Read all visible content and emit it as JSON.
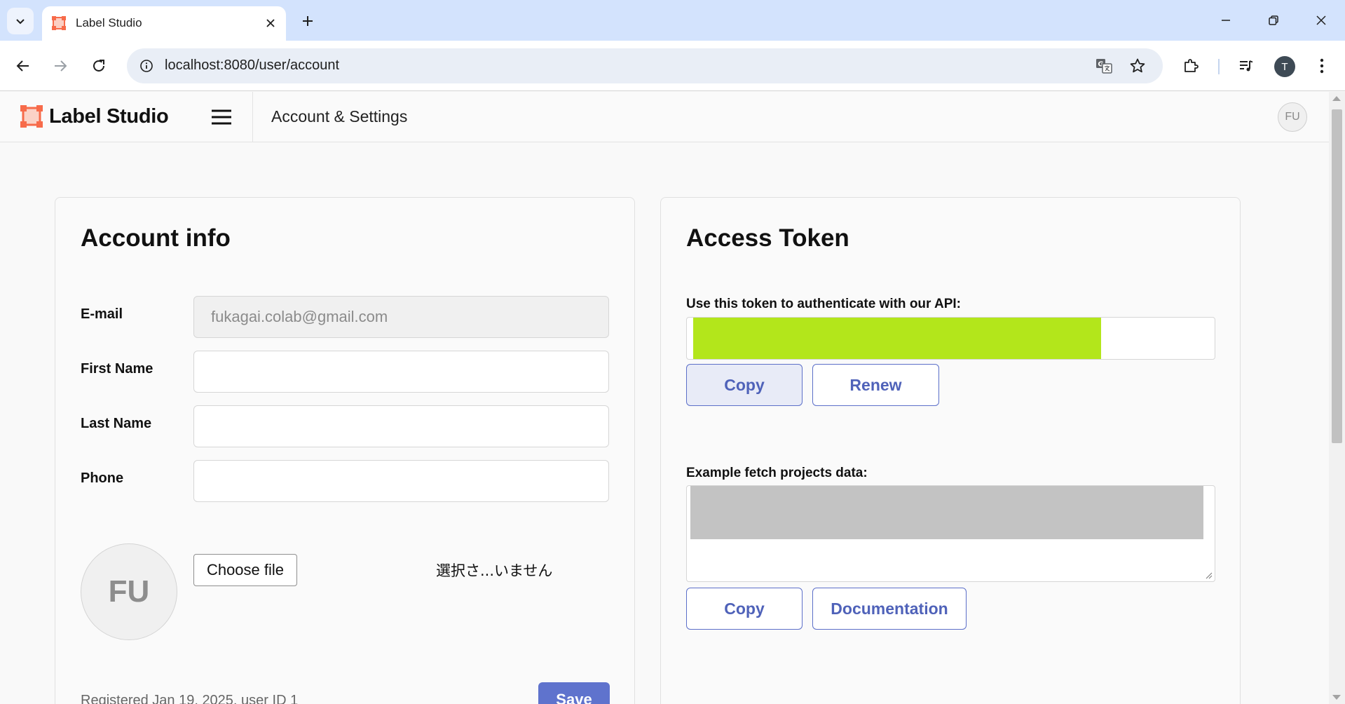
{
  "browser": {
    "tab_title": "Label Studio",
    "url": "localhost:8080/user/account",
    "profile_initial": "T"
  },
  "header": {
    "brand": "Label Studio",
    "page_title": "Account & Settings",
    "user_initials": "FU"
  },
  "account": {
    "title": "Account info",
    "email_label": "E-mail",
    "email_value": "fukagai.colab@gmail.com",
    "first_name_label": "First Name",
    "first_name_value": "",
    "last_name_label": "Last Name",
    "last_name_value": "",
    "phone_label": "Phone",
    "phone_value": "",
    "avatar_initials": "FU",
    "choose_file_label": "Choose file",
    "no_file_text": "選択さ...いません",
    "registered_text": "Registered Jan 19, 2025, user ID 1",
    "save_label": "Save"
  },
  "token": {
    "title": "Access Token",
    "instruction": "Use this token to authenticate with our API:",
    "copy_label": "Copy",
    "renew_label": "Renew",
    "example_label": "Example fetch projects data:",
    "example_copy_label": "Copy",
    "documentation_label": "Documentation"
  },
  "colors": {
    "brand_orange": "#f76b4a",
    "accent_blue": "#5f73cd",
    "token_redaction": "#b3e61b",
    "example_redaction": "#c3c3c3"
  }
}
